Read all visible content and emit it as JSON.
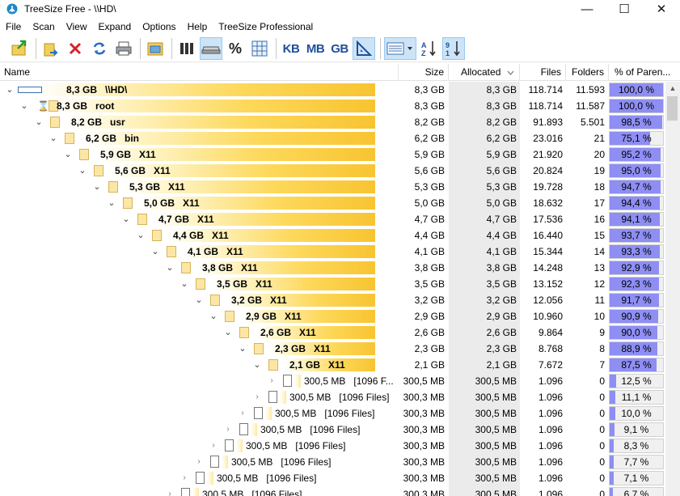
{
  "window": {
    "title": "TreeSize Free - \\\\HD\\",
    "minimize": "—",
    "maximize": "☐",
    "close": "✕"
  },
  "menu": [
    "File",
    "Scan",
    "View",
    "Expand",
    "Options",
    "Help",
    "TreeSize Professional"
  ],
  "toolbar": {
    "percent": "%",
    "kb": "KB",
    "mb": "MB",
    "gb": "GB"
  },
  "columns": {
    "name": "Name",
    "size": "Size",
    "allocated": "Allocated",
    "files": "Files",
    "folders": "Folders",
    "percent_of_parent": "% of Paren..."
  },
  "rows": [
    {
      "level": 0,
      "chevron": "open",
      "icon": "drive",
      "bar_fraction": 1.0,
      "label": "8,3 GB   \\\\HD\\",
      "bold": true,
      "size": "8,3 GB",
      "allocated": "8,3 GB",
      "files": "118.714",
      "folders": "11.593",
      "pct": "100,0 %",
      "pct_value": 100.0
    },
    {
      "level": 1,
      "chevron": "open",
      "icon": "waiting",
      "bar_fraction": 1.0,
      "label": "8,3 GB   root",
      "bold": true,
      "size": "8,3 GB",
      "allocated": "8,3 GB",
      "files": "118.714",
      "folders": "11.587",
      "pct": "100,0 %",
      "pct_value": 100.0
    },
    {
      "level": 2,
      "chevron": "open",
      "icon": "folder",
      "bar_fraction": 0.985,
      "label": "8,2 GB   usr",
      "bold": true,
      "size": "8,2 GB",
      "allocated": "8,2 GB",
      "files": "91.893",
      "folders": "5.501",
      "pct": "98,5 %",
      "pct_value": 98.5
    },
    {
      "level": 3,
      "chevron": "open",
      "icon": "folder",
      "bar_fraction": 0.751,
      "label": "6,2 GB   bin",
      "bold": true,
      "size": "6,2 GB",
      "allocated": "6,2 GB",
      "files": "23.016",
      "folders": "21",
      "pct": "75,1 %",
      "pct_value": 75.1
    },
    {
      "level": 4,
      "chevron": "open",
      "icon": "folder",
      "bar_fraction": 0.952,
      "label": "5,9 GB   X11",
      "bold": true,
      "size": "5,9 GB",
      "allocated": "5,9 GB",
      "files": "21.920",
      "folders": "20",
      "pct": "95,2 %",
      "pct_value": 95.2
    },
    {
      "level": 5,
      "chevron": "open",
      "icon": "folder",
      "bar_fraction": 0.95,
      "label": "5,6 GB   X11",
      "bold": true,
      "size": "5,6 GB",
      "allocated": "5,6 GB",
      "files": "20.824",
      "folders": "19",
      "pct": "95,0 %",
      "pct_value": 95.0
    },
    {
      "level": 6,
      "chevron": "open",
      "icon": "folder",
      "bar_fraction": 0.947,
      "label": "5,3 GB   X11",
      "bold": true,
      "size": "5,3 GB",
      "allocated": "5,3 GB",
      "files": "19.728",
      "folders": "18",
      "pct": "94,7 %",
      "pct_value": 94.7
    },
    {
      "level": 7,
      "chevron": "open",
      "icon": "folder",
      "bar_fraction": 0.944,
      "label": "5,0 GB   X11",
      "bold": true,
      "size": "5,0 GB",
      "allocated": "5,0 GB",
      "files": "18.632",
      "folders": "17",
      "pct": "94,4 %",
      "pct_value": 94.4
    },
    {
      "level": 8,
      "chevron": "open",
      "icon": "folder",
      "bar_fraction": 0.941,
      "label": "4,7 GB   X11",
      "bold": true,
      "size": "4,7 GB",
      "allocated": "4,7 GB",
      "files": "17.536",
      "folders": "16",
      "pct": "94,1 %",
      "pct_value": 94.1
    },
    {
      "level": 9,
      "chevron": "open",
      "icon": "folder",
      "bar_fraction": 0.937,
      "label": "4,4 GB   X11",
      "bold": true,
      "size": "4,4 GB",
      "allocated": "4,4 GB",
      "files": "16.440",
      "folders": "15",
      "pct": "93,7 %",
      "pct_value": 93.7
    },
    {
      "level": 10,
      "chevron": "open",
      "icon": "folder",
      "bar_fraction": 0.933,
      "label": "4,1 GB   X11",
      "bold": true,
      "size": "4,1 GB",
      "allocated": "4,1 GB",
      "files": "15.344",
      "folders": "14",
      "pct": "93,3 %",
      "pct_value": 93.3
    },
    {
      "level": 11,
      "chevron": "open",
      "icon": "folder",
      "bar_fraction": 0.929,
      "label": "3,8 GB   X11",
      "bold": true,
      "size": "3,8 GB",
      "allocated": "3,8 GB",
      "files": "14.248",
      "folders": "13",
      "pct": "92,9 %",
      "pct_value": 92.9
    },
    {
      "level": 12,
      "chevron": "open",
      "icon": "folder",
      "bar_fraction": 0.923,
      "label": "3,5 GB   X11",
      "bold": true,
      "size": "3,5 GB",
      "allocated": "3,5 GB",
      "files": "13.152",
      "folders": "12",
      "pct": "92,3 %",
      "pct_value": 92.3
    },
    {
      "level": 13,
      "chevron": "open",
      "icon": "folder",
      "bar_fraction": 0.917,
      "label": "3,2 GB   X11",
      "bold": true,
      "size": "3,2 GB",
      "allocated": "3,2 GB",
      "files": "12.056",
      "folders": "11",
      "pct": "91,7 %",
      "pct_value": 91.7
    },
    {
      "level": 14,
      "chevron": "open",
      "icon": "folder",
      "bar_fraction": 0.909,
      "label": "2,9 GB   X11",
      "bold": true,
      "size": "2,9 GB",
      "allocated": "2,9 GB",
      "files": "10.960",
      "folders": "10",
      "pct": "90,9 %",
      "pct_value": 90.9
    },
    {
      "level": 15,
      "chevron": "open",
      "icon": "folder",
      "bar_fraction": 0.9,
      "label": "2,6 GB   X11",
      "bold": true,
      "size": "2,6 GB",
      "allocated": "2,6 GB",
      "files": "9.864",
      "folders": "9",
      "pct": "90,0 %",
      "pct_value": 90.0
    },
    {
      "level": 16,
      "chevron": "open",
      "icon": "folder",
      "bar_fraction": 0.889,
      "label": "2,3 GB   X11",
      "bold": true,
      "size": "2,3 GB",
      "allocated": "2,3 GB",
      "files": "8.768",
      "folders": "8",
      "pct": "88,9 %",
      "pct_value": 88.9
    },
    {
      "level": 17,
      "chevron": "open",
      "icon": "folder",
      "bar_fraction": 0.875,
      "label": "2,1 GB   X11",
      "bold": true,
      "size": "2,1 GB",
      "allocated": "2,1 GB",
      "files": "7.672",
      "folders": "7",
      "pct": "87,5 %",
      "pct_value": 87.5
    },
    {
      "level": 18,
      "chevron": "closed",
      "icon": "files",
      "bar_fraction": 0.0,
      "label": "300,5 MB   [1096 F...",
      "bold": false,
      "size": "300,5 MB",
      "allocated": "300,5 MB",
      "files": "1.096",
      "folders": "0",
      "pct": "12,5 %",
      "pct_value": 12.5
    },
    {
      "level": 17,
      "chevron": "closed",
      "icon": "files",
      "bar_fraction": 0.0,
      "label": "300,5 MB   [1096 Files]",
      "bold": false,
      "size": "300,3 MB",
      "allocated": "300,5 MB",
      "files": "1.096",
      "folders": "0",
      "pct": "11,1 %",
      "pct_value": 11.1
    },
    {
      "level": 16,
      "chevron": "closed",
      "icon": "files",
      "bar_fraction": 0.0,
      "label": "300,5 MB   [1096 Files]",
      "bold": false,
      "size": "300,3 MB",
      "allocated": "300,5 MB",
      "files": "1.096",
      "folders": "0",
      "pct": "10,0 %",
      "pct_value": 10.0
    },
    {
      "level": 15,
      "chevron": "closed",
      "icon": "files",
      "bar_fraction": 0.0,
      "label": "300,5 MB   [1096 Files]",
      "bold": false,
      "size": "300,3 MB",
      "allocated": "300,5 MB",
      "files": "1.096",
      "folders": "0",
      "pct": "9,1 %",
      "pct_value": 9.1
    },
    {
      "level": 14,
      "chevron": "closed",
      "icon": "files",
      "bar_fraction": 0.0,
      "label": "300,5 MB   [1096 Files]",
      "bold": false,
      "size": "300,3 MB",
      "allocated": "300,5 MB",
      "files": "1.096",
      "folders": "0",
      "pct": "8,3 %",
      "pct_value": 8.3
    },
    {
      "level": 13,
      "chevron": "closed",
      "icon": "files",
      "bar_fraction": 0.0,
      "label": "300,5 MB   [1096 Files]",
      "bold": false,
      "size": "300,3 MB",
      "allocated": "300,5 MB",
      "files": "1.096",
      "folders": "0",
      "pct": "7,7 %",
      "pct_value": 7.7
    },
    {
      "level": 12,
      "chevron": "closed",
      "icon": "files",
      "bar_fraction": 0.0,
      "label": "300,5 MB   [1096 Files]",
      "bold": false,
      "size": "300,3 MB",
      "allocated": "300,5 MB",
      "files": "1.096",
      "folders": "0",
      "pct": "7,1 %",
      "pct_value": 7.1
    },
    {
      "level": 11,
      "chevron": "closed",
      "icon": "files",
      "bar_fraction": 0.0,
      "label": "300,5 MB   [1096 Files]",
      "bold": false,
      "size": "300,3 MB",
      "allocated": "300,5 MB",
      "files": "1.096",
      "folders": "0",
      "pct": "6,7 %",
      "pct_value": 6.7
    }
  ],
  "colors": {
    "percent_bar": "#8e8ef4",
    "size_bar": "#f8c431",
    "allocated_column_bg": "#ebebeb",
    "toolbar_text": "#1f4e9a"
  },
  "icons": {
    "toolbar": [
      "scan-folder-icon",
      "open-folder-icon",
      "delete-icon",
      "refresh-icon",
      "print-icon",
      "explorer-icon",
      "columns-icon",
      "drive-icon",
      "percent-icon",
      "grid-icon",
      "kb-icon",
      "mb-icon",
      "gb-icon",
      "ruler-icon",
      "view-options-icon",
      "sort-name-icon",
      "sort-size-icon"
    ]
  }
}
